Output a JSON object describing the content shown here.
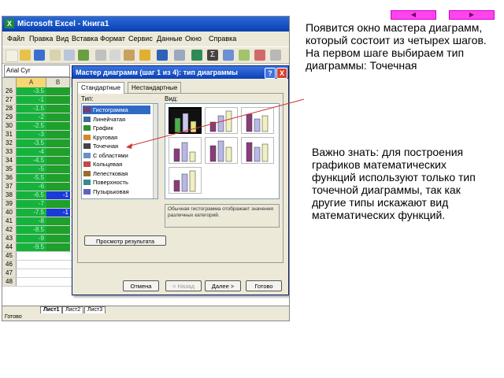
{
  "slide": {
    "main_text": "Появится окно мастера диаграмм, который состоит из четырех шагов. На первом шаге выбираем тип диаграммы: Точечная",
    "note_text": "Важно знать: для построения графиков математических функций используют только тип точечной диаграммы, так как другие типы искажают вид математических функций.",
    "nav_prev_icon": "◀",
    "nav_next_icon": "▶",
    "nav_color": "#ff44ee"
  },
  "excel": {
    "window_title": "Microsoft Excel - Книга1",
    "menu": [
      "Файл",
      "Правка",
      "Вид",
      "Вставка",
      "Формат",
      "Сервис",
      "Данные",
      "Окно",
      "Справка"
    ],
    "name_box": "Arial Cyr",
    "columns": [
      "A",
      "B"
    ],
    "rows": [
      {
        "num": "26",
        "a": "-3.5",
        "b": ""
      },
      {
        "num": "27",
        "a": "-1",
        "b": ""
      },
      {
        "num": "28",
        "a": "-1.5",
        "b": ""
      },
      {
        "num": "29",
        "a": "-2",
        "b": ""
      },
      {
        "num": "30",
        "a": "-2.5",
        "b": ""
      },
      {
        "num": "31",
        "a": "-3",
        "b": ""
      },
      {
        "num": "32",
        "a": "-3.5",
        "b": ""
      },
      {
        "num": "33",
        "a": "-4",
        "b": ""
      },
      {
        "num": "34",
        "a": "-4.5",
        "b": ""
      },
      {
        "num": "35",
        "a": "-5",
        "b": ""
      },
      {
        "num": "36",
        "a": "-5.5",
        "b": ""
      },
      {
        "num": "37",
        "a": "-6",
        "b": ""
      },
      {
        "num": "38",
        "a": "-6.5",
        "b": "-1"
      },
      {
        "num": "39",
        "a": "-7",
        "b": ""
      },
      {
        "num": "40",
        "a": "-7.5",
        "b": "-1"
      },
      {
        "num": "41",
        "a": "-8",
        "b": ""
      },
      {
        "num": "42",
        "a": "-8.5",
        "b": ""
      },
      {
        "num": "43",
        "a": "-9",
        "b": ""
      },
      {
        "num": "44",
        "a": "-9.5",
        "b": ""
      },
      {
        "num": "45",
        "a": "",
        "b": ""
      },
      {
        "num": "46",
        "a": "",
        "b": ""
      },
      {
        "num": "47",
        "a": "",
        "b": ""
      },
      {
        "num": "48",
        "a": "",
        "b": ""
      }
    ],
    "sheet_tabs": [
      "Лист1",
      "Лист2",
      "Лист3"
    ],
    "status": "Готово",
    "colors": {
      "col_a": "#16b33c",
      "col_b": "#1ea02b",
      "titlebar": "#0a3fb0"
    }
  },
  "dialog": {
    "title": "Мастер диаграмм (шаг 1 из 4): тип диаграммы",
    "help_icon": "?",
    "close_icon": "X",
    "tabs": [
      "Стандартные",
      "Нестандартные"
    ],
    "type_label": "Тип:",
    "view_label": "Вид:",
    "types": [
      {
        "label": "Гистограмма",
        "icon": "bar-chart-icon",
        "selected": true
      },
      {
        "label": "Линейчатая",
        "icon": "horizontal-bar-icon",
        "selected": false
      },
      {
        "label": "График",
        "icon": "line-chart-icon",
        "selected": false
      },
      {
        "label": "Круговая",
        "icon": "pie-chart-icon",
        "selected": false
      },
      {
        "label": "Точечная",
        "icon": "scatter-chart-icon",
        "selected": false
      },
      {
        "label": "С областями",
        "icon": "area-chart-icon",
        "selected": false
      },
      {
        "label": "Кольцевая",
        "icon": "doughnut-chart-icon",
        "selected": false
      },
      {
        "label": "Лепестковая",
        "icon": "radar-chart-icon",
        "selected": false
      },
      {
        "label": "Поверхность",
        "icon": "surface-chart-icon",
        "selected": false
      },
      {
        "label": "Пузырьковая",
        "icon": "bubble-chart-icon",
        "selected": false
      }
    ],
    "description": "Обычная гистограмма отображает значения различных категорий.",
    "preview_button": "Просмотр результата",
    "buttons": {
      "cancel": "Отмена",
      "back": "< Назад",
      "next": "Далее >",
      "finish": "Готово"
    }
  }
}
